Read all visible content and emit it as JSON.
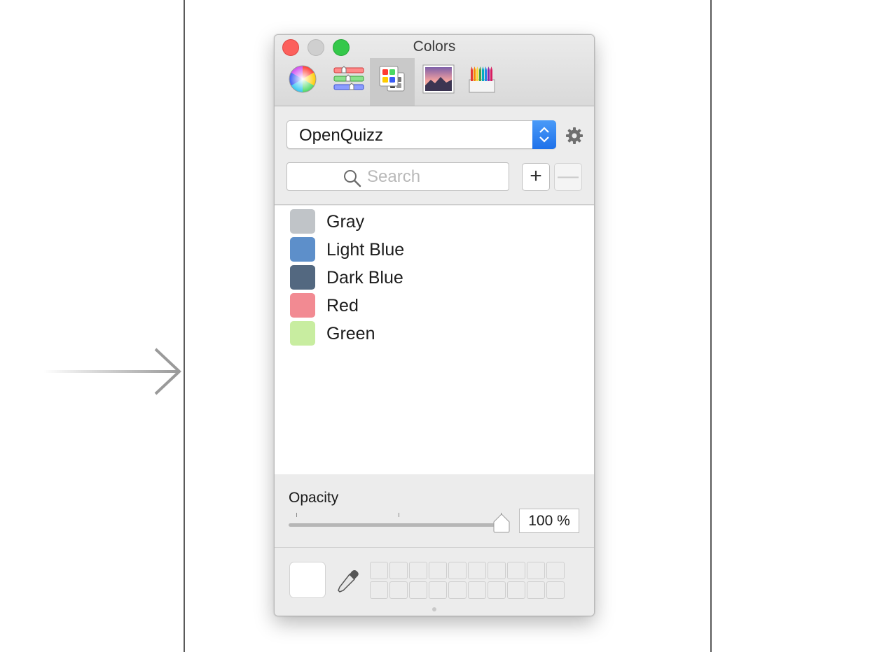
{
  "window": {
    "title": "Colors"
  },
  "toolbar": {
    "tools": [
      {
        "icon": "color-wheel-icon"
      },
      {
        "icon": "color-sliders-icon"
      },
      {
        "icon": "color-palettes-icon",
        "active": true
      },
      {
        "icon": "image-palettes-icon"
      },
      {
        "icon": "pencils-icon"
      }
    ]
  },
  "palette": {
    "selected": "OpenQuizz",
    "search_placeholder": "Search",
    "colors": [
      {
        "name": "Gray",
        "hex": "#c0c4c8"
      },
      {
        "name": "Light Blue",
        "hex": "#5d8fca"
      },
      {
        "name": "Dark Blue",
        "hex": "#536880"
      },
      {
        "name": "Red",
        "hex": "#f28a92"
      },
      {
        "name": "Green",
        "hex": "#c8eda0"
      }
    ]
  },
  "buttons": {
    "add": "+",
    "remove": "—"
  },
  "opacity": {
    "label": "Opacity",
    "value_text": "100 %",
    "value": 1.0
  },
  "current_color": "#ffffff"
}
